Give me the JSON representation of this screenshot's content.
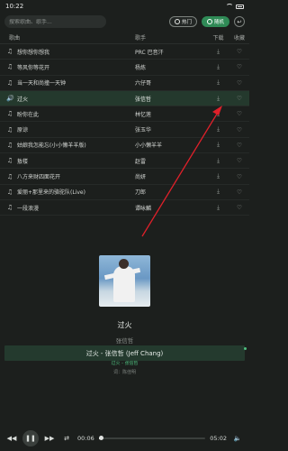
{
  "status_bar": {
    "time": "10:22"
  },
  "search": {
    "placeholder": "搜索歌曲、歌手..."
  },
  "chips": [
    {
      "label": "热门",
      "active": false
    },
    {
      "label": "随机",
      "active": true
    }
  ],
  "back_button_icon": "back-arrow-icon",
  "table_headers": {
    "song": "歌曲",
    "singer": "歌手",
    "download": "下载",
    "favorite": "收藏"
  },
  "songs": [
    {
      "name": "想你想你想我",
      "singer": "PRC 巴音汗",
      "playing": false
    },
    {
      "name": "等风你等花开",
      "singer": "杨炼",
      "playing": false
    },
    {
      "name": "当一天和尚撞一天钟",
      "singer": "六仔哥",
      "playing": false
    },
    {
      "name": "过火",
      "singer": "张信哲",
      "playing": true
    },
    {
      "name": "盼你在此",
      "singer": "林忆莲",
      "playing": false
    },
    {
      "name": "原谅",
      "singer": "张玉华",
      "playing": false
    },
    {
      "name": "姑娘我怎能忘(小小懒羊羊版)",
      "singer": "小小懒羊羊",
      "playing": false
    },
    {
      "name": "敖楼",
      "singer": "赵雷",
      "playing": false
    },
    {
      "name": "八方来财四面花开",
      "singer": "尚妍",
      "playing": false
    },
    {
      "name": "爱丽+那里来的骆驼队(Live)",
      "singer": "刀郎",
      "playing": false
    },
    {
      "name": "一段浪漫",
      "singer": "谭咏麟",
      "playing": false
    }
  ],
  "now_playing": {
    "title": "过火",
    "artist": "张信哲",
    "small_line": "过火 - 张信哲",
    "lyric_line": "过火 - 张信哲 (Jeff Chang)",
    "credit": "词：陈佳明"
  },
  "player": {
    "current_time": "00:06",
    "total_time": "05:02",
    "progress": 0.02
  },
  "colors": {
    "accent": "#2f8a56",
    "playing_row": "#24392d",
    "annotation": "#e0202a"
  }
}
